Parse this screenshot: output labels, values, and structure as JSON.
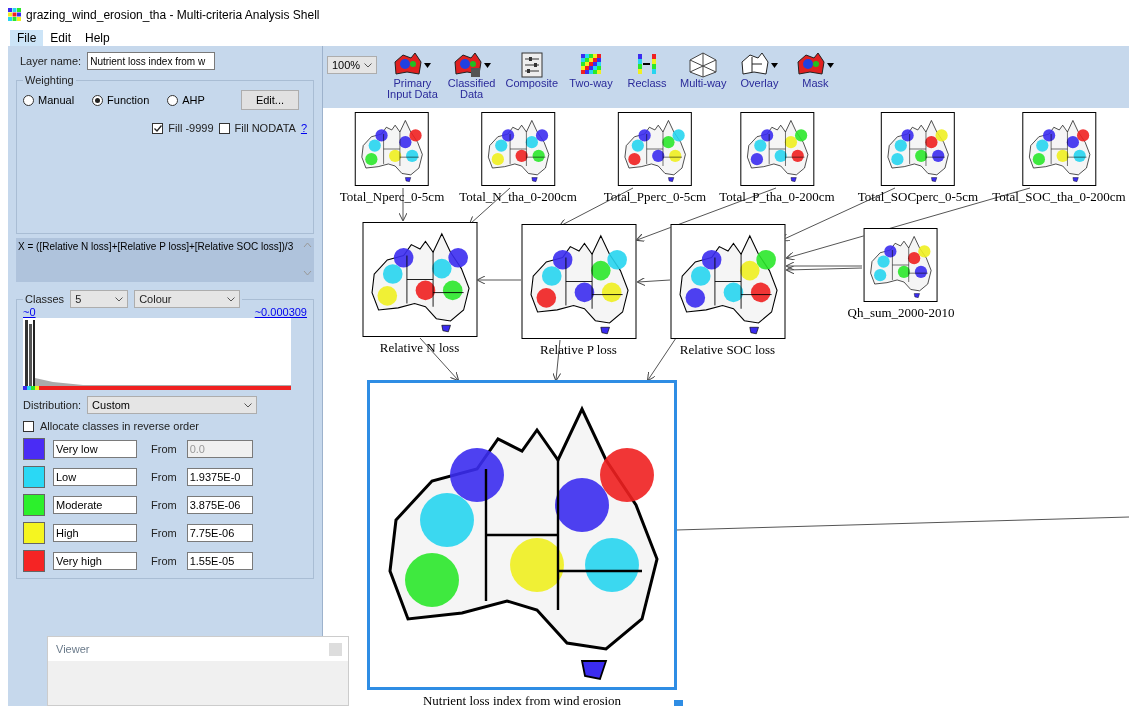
{
  "window": {
    "title": "grazing_wind_erosion_tha - Multi-criteria Analysis Shell"
  },
  "menu": [
    {
      "label": "File",
      "selected": true
    },
    {
      "label": "Edit",
      "selected": false
    },
    {
      "label": "Help",
      "selected": false
    }
  ],
  "layer_name": {
    "label": "Layer name:",
    "value": "Nutrient loss index from w"
  },
  "weighting": {
    "title": "Weighting",
    "options": [
      {
        "label": "Manual",
        "selected": false
      },
      {
        "label": "Function",
        "selected": true
      },
      {
        "label": "AHP",
        "selected": false
      }
    ],
    "edit_button": "Edit...",
    "fill_9999": {
      "label": "Fill -9999",
      "checked": true
    },
    "fill_nodata": {
      "label": "Fill NODATA",
      "checked": false
    },
    "help_link": "?"
  },
  "formula": "X = ([Relative N loss]+[Relative P loss]+[Relative SOC loss])/3",
  "classes": {
    "title": "Classes",
    "count": "5",
    "mode": "Colour",
    "min_link": "~0",
    "max_link": "~0.000309",
    "distribution_label": "Distribution:",
    "distribution": "Custom",
    "reverse": {
      "label": "Allocate classes in reverse order",
      "checked": false
    },
    "rows": [
      {
        "name": "Very low",
        "color": "#4a2cf5",
        "from_label": "From",
        "from": "0.0",
        "disabled": true
      },
      {
        "name": "Low",
        "color": "#2ad8f5",
        "from_label": "From",
        "from": "1.9375E-0",
        "disabled": false
      },
      {
        "name": "Moderate",
        "color": "#2cf02c",
        "from_label": "From",
        "from": "3.875E-06",
        "disabled": false
      },
      {
        "name": "High",
        "color": "#f5f520",
        "from_label": "From",
        "from": "7.75E-06",
        "disabled": false
      },
      {
        "name": "Very high",
        "color": "#f52424",
        "from_label": "From",
        "from": "1.55E-05",
        "disabled": false
      }
    ]
  },
  "viewer": {
    "title": "Viewer"
  },
  "zoom": "100%",
  "toolbar": [
    {
      "label": "Primary\nInput Data",
      "dropdown": true
    },
    {
      "label": "Classified\nData",
      "dropdown": true
    },
    {
      "label": "Composite",
      "dropdown": false
    },
    {
      "label": "Two-way",
      "dropdown": false
    },
    {
      "label": "Reclass",
      "dropdown": false
    },
    {
      "label": "Multi-way",
      "dropdown": false
    },
    {
      "label": "Overlay",
      "dropdown": true
    },
    {
      "label": "Mask",
      "dropdown": true
    }
  ],
  "nodes": [
    {
      "label": "Total_Nperc_0-5cm",
      "selected": false
    },
    {
      "label": "Total_N_tha_0-200cm",
      "selected": false
    },
    {
      "label": "Total_Pperc_0-5cm",
      "selected": false
    },
    {
      "label": "Total_P_tha_0-200cm",
      "selected": false
    },
    {
      "label": "Total_SOCperc_0-5cm",
      "selected": false
    },
    {
      "label": "Total_SOC_tha_0-200cm",
      "selected": false
    },
    {
      "label": "Relative N loss",
      "selected": false
    },
    {
      "label": "Relative P loss",
      "selected": false
    },
    {
      "label": "Relative SOC loss",
      "selected": false
    },
    {
      "label": "Qh_sum_2000-2010",
      "selected": false
    },
    {
      "label": "Nutrient loss index from wind erosion",
      "selected": true
    }
  ]
}
